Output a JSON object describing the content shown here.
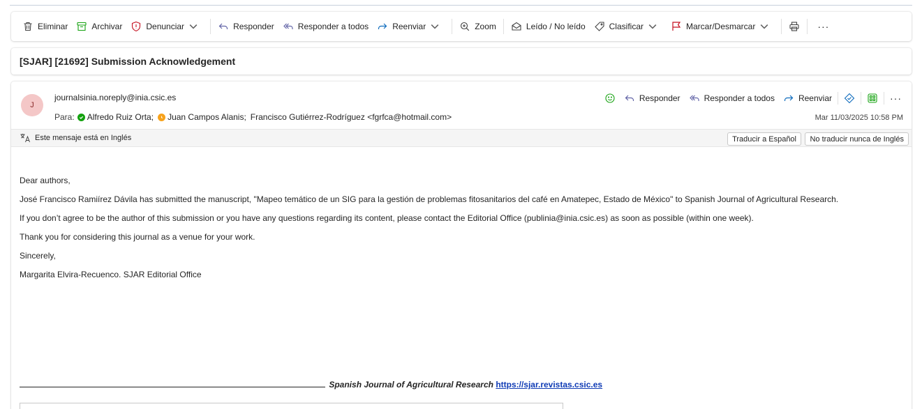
{
  "toolbar": {
    "delete": "Eliminar",
    "archive": "Archivar",
    "report": "Denunciar",
    "reply": "Responder",
    "reply_all": "Responder a todos",
    "forward": "Reenviar",
    "zoom": "Zoom",
    "read_unread": "Leído / No leído",
    "categorize": "Clasificar",
    "flag": "Marcar/Desmarcar",
    "more": "···"
  },
  "subject": "[SJAR] [21692] Submission Acknowledgement",
  "message": {
    "avatar_initial": "J",
    "from": "journalsinia.noreply@inia.csic.es",
    "to_label": "Para:",
    "recipients": [
      "Alfredo Ruiz Orta;",
      "Juan Campos Alanis;",
      "Francisco Gutiérrez-Rodríguez <fgrfca@hotmail.com>"
    ],
    "date": "Mar 11/03/2025 10:58 PM",
    "actions": {
      "reply": "Responder",
      "reply_all": "Responder a todos",
      "forward": "Reenviar",
      "more": "···"
    }
  },
  "translation": {
    "notice": "Este mensaje está en Inglés",
    "translate_button": "Traducir a Español",
    "never_button": "No traducir nunca de Inglés"
  },
  "body": {
    "greeting": "Dear authors,",
    "p1": "José Francisco Ramiírez Dávila has submitted the manuscript, \"Mapeo temático de un SIG para la gestión de problemas fitosanitarios del café en Amatepec, Estado de México\" to Spanish Journal of Agricultural Research.",
    "p2": "If you don’t agree to be the author of this submission or you have any questions regarding its content, please contact the Editorial Office (publinia@inia.csic.es) as soon as possible (within one week).",
    "p3": "Thank you for considering this journal as a venue for your work.",
    "closing": "Sincerely,",
    "signature": "Margarita Elvira-Recuenco. SJAR Editorial Office"
  },
  "footer": {
    "journal": "Spanish Journal of Agricultural Research",
    "link": "https://sjar.revistas.csic.es"
  },
  "colors": {
    "link": "#0f3bb5",
    "flag_red": "#c50f1f",
    "reply_purple": "#6264a7",
    "avatar_bg": "#f4c7c7"
  }
}
